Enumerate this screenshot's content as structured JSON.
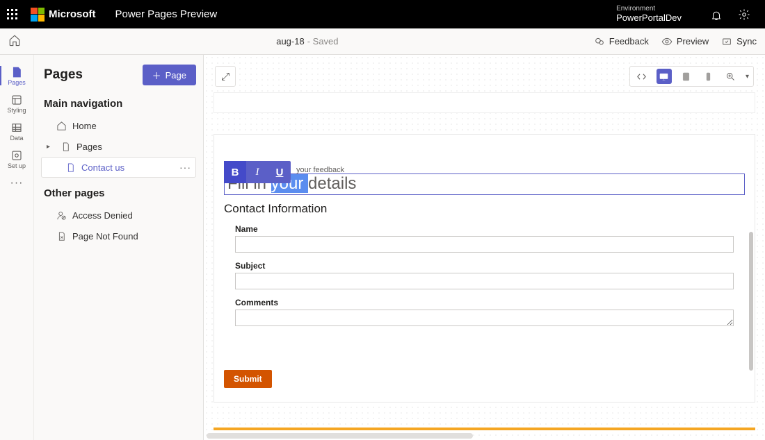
{
  "topbar": {
    "brand": "Microsoft",
    "app_title": "Power Pages Preview",
    "environment_label": "Environment",
    "environment_name": "PowerPortalDev"
  },
  "cmdbar": {
    "doc_name": "aug-18",
    "status": " - Saved",
    "feedback": "Feedback",
    "preview": "Preview",
    "sync": "Sync"
  },
  "rail": {
    "pages": "Pages",
    "styling": "Styling",
    "data": "Data",
    "setup": "Set up"
  },
  "panel": {
    "title": "Pages",
    "add_page": "Page",
    "sections": {
      "main_nav": "Main navigation",
      "other": "Other pages"
    },
    "tree": {
      "home": "Home",
      "pages": "Pages",
      "contact": "Contact us",
      "access_denied": "Access Denied",
      "not_found": "Page Not Found"
    }
  },
  "editor": {
    "crumb": "your feedback",
    "heading_pre": "Fill in ",
    "heading_sel": "your ",
    "heading_post": "details",
    "section_title": "Contact Information",
    "fields": {
      "name": "Name",
      "subject": "Subject",
      "comments": "Comments"
    },
    "submit": "Submit",
    "fmt": {
      "bold": "B",
      "italic": "I",
      "underline": "U"
    }
  }
}
